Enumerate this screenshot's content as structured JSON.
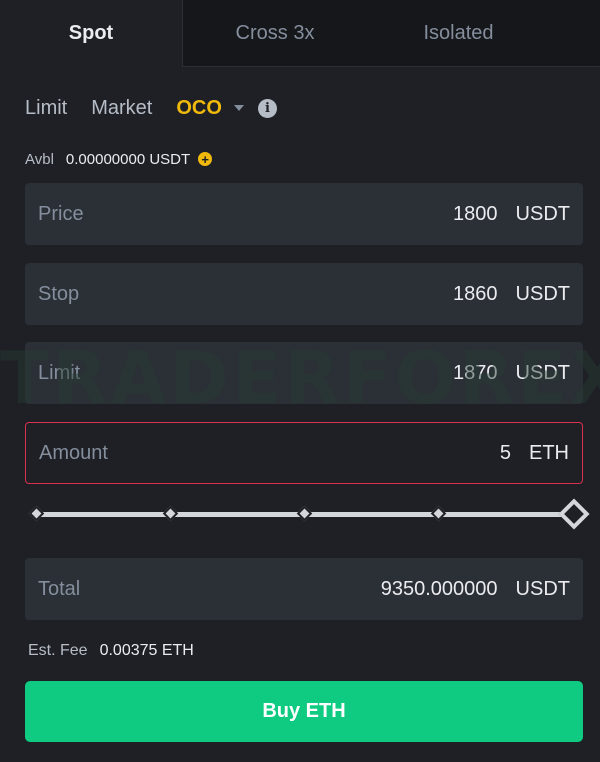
{
  "tabs": {
    "spot": "Spot",
    "cross": "Cross 3x",
    "isolated": "Isolated"
  },
  "order_types": {
    "limit": "Limit",
    "market": "Market",
    "oco": "OCO",
    "active": "OCO"
  },
  "avbl": {
    "label": "Avbl",
    "value": "0.00000000 USDT"
  },
  "fields": {
    "price": {
      "label": "Price",
      "value": "1800",
      "unit": "USDT"
    },
    "stop": {
      "label": "Stop",
      "value": "1860",
      "unit": "USDT"
    },
    "limit": {
      "label": "Limit",
      "value": "1870",
      "unit": "USDT"
    },
    "amount": {
      "label": "Amount",
      "value": "5",
      "unit": "ETH"
    },
    "total": {
      "label": "Total",
      "value": "9350.000000",
      "unit": "USDT"
    }
  },
  "slider": {
    "percent": 100
  },
  "fee": {
    "label": "Est. Fee",
    "value": "0.00375 ETH"
  },
  "buy_button": "Buy ETH",
  "watermark": "TRADERFOREX",
  "colors": {
    "background": "#1e2026",
    "accent": "#f0b90b",
    "buy": "#0ecb81",
    "error_border": "#d9304e"
  }
}
